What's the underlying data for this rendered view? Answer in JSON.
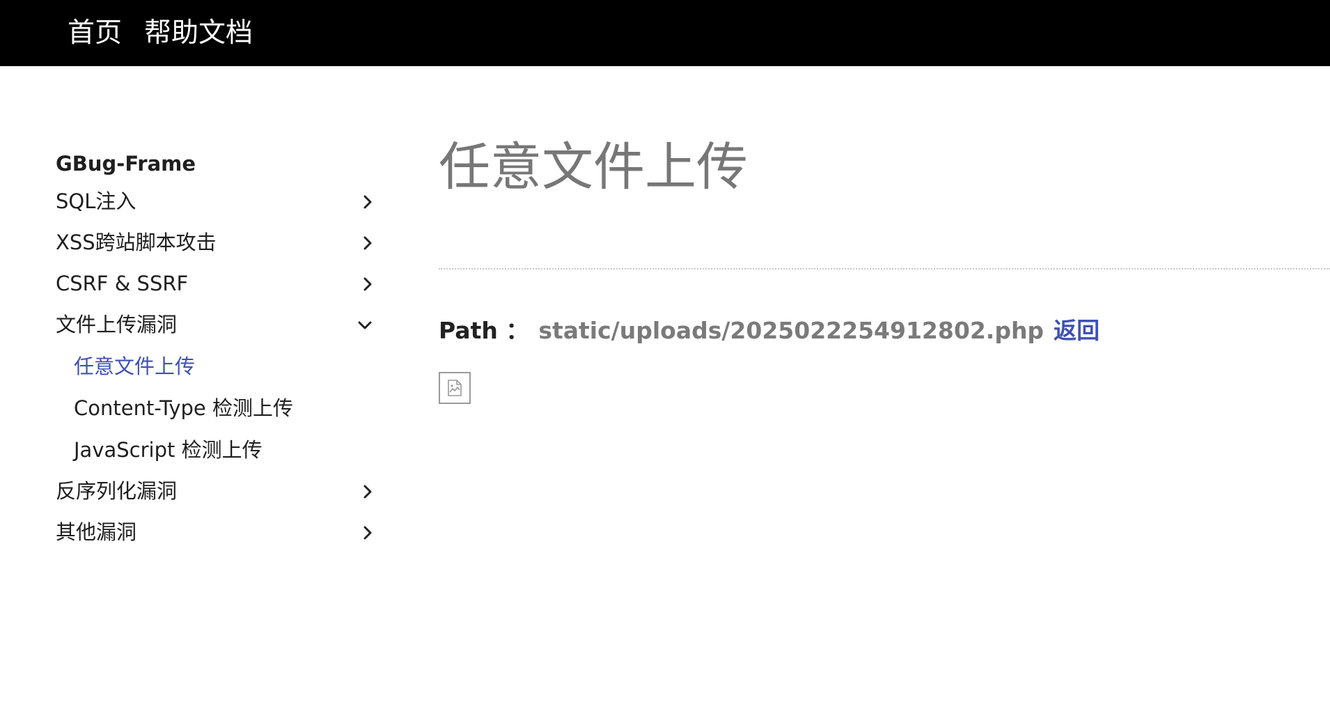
{
  "topnav": {
    "home": "首页",
    "help": "帮助文档"
  },
  "sidebar": {
    "brand": "GBug-Frame",
    "items": [
      {
        "label": "SQL注入",
        "icon": "chevron-right-icon"
      },
      {
        "label": "XSS跨站脚本攻击",
        "icon": "chevron-right-icon"
      },
      {
        "label": "CSRF & SSRF",
        "icon": "chevron-right-icon"
      },
      {
        "label": "文件上传漏洞",
        "icon": "chevron-down-icon",
        "expanded": true
      },
      {
        "label": "反序列化漏洞",
        "icon": "chevron-right-icon"
      },
      {
        "label": "其他漏洞",
        "icon": "chevron-right-icon"
      }
    ],
    "subitems": [
      {
        "label": "任意文件上传",
        "active": true
      },
      {
        "label": "Content-Type 检测上传",
        "active": false
      },
      {
        "label": "JavaScript 检测上传",
        "active": false
      }
    ]
  },
  "main": {
    "title": "任意文件上传",
    "path_label": "Path ：",
    "path_value": "static/uploads/2025022254912802.php",
    "back_label": "返回",
    "image_icon": "broken-image-icon"
  },
  "colors": {
    "accent": "#3f51b5",
    "topbar": "#000000",
    "muted": "#7a7a7a"
  }
}
